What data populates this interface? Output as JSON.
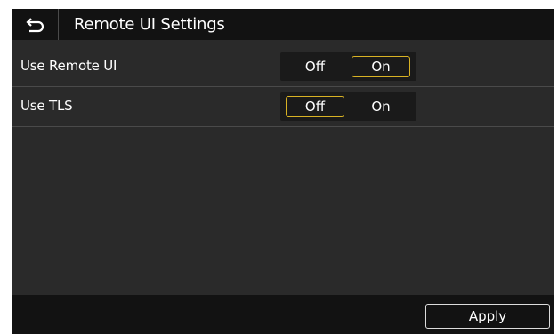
{
  "header": {
    "title": "Remote UI Settings",
    "back_icon": "back-arrow-icon"
  },
  "settings": [
    {
      "label": "Use Remote UI",
      "options": [
        "Off",
        "On"
      ],
      "selected": "On"
    },
    {
      "label": "Use TLS",
      "options": [
        "Off",
        "On"
      ],
      "selected": "Off"
    }
  ],
  "footer": {
    "apply_label": "Apply"
  },
  "colors": {
    "background": "#2a2a2a",
    "bar": "#121212",
    "accent_selected": "#d8b224",
    "text": "#ffffff"
  }
}
